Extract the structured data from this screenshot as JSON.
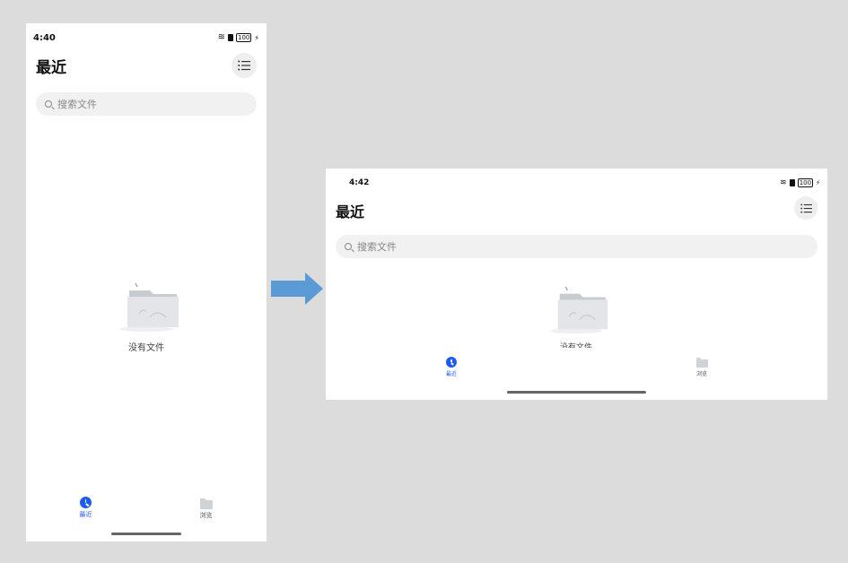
{
  "portrait": {
    "status": {
      "time": "4:40",
      "battery": "100"
    },
    "title": "最近",
    "menu_icon": "list-icon",
    "search": {
      "placeholder": "搜索文件"
    },
    "empty": {
      "label": "没有文件"
    },
    "tabs": [
      {
        "label": "最近",
        "icon": "clock-icon",
        "active": true
      },
      {
        "label": "浏览",
        "icon": "folder-icon",
        "active": false
      }
    ]
  },
  "landscape": {
    "status": {
      "time": "4:42",
      "battery": "100"
    },
    "title": "最近",
    "menu_icon": "list-icon",
    "search": {
      "placeholder": "搜索文件"
    },
    "empty": {
      "label": "没有文件"
    },
    "tabs": [
      {
        "label": "最近",
        "icon": "clock-icon",
        "active": true
      },
      {
        "label": "浏览",
        "icon": "folder-icon",
        "active": false
      }
    ]
  },
  "colors": {
    "accent": "#1d5cf0",
    "arrow": "#5b9bd5",
    "background": "#dcdcdc"
  }
}
